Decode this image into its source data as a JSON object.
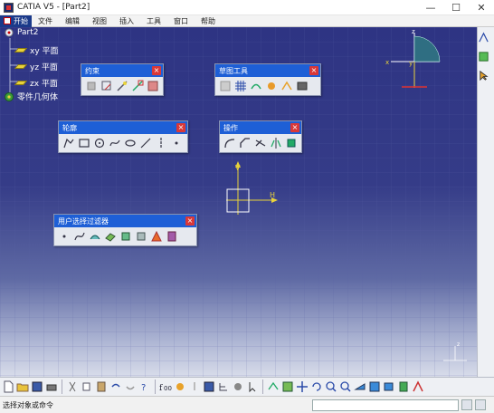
{
  "window": {
    "title": "CATIA V5 - [Part2]",
    "minimize": "—",
    "maximize": "☐",
    "close": "✕"
  },
  "menu": {
    "start": "开始",
    "items": [
      "文件",
      "编辑",
      "视图",
      "插入",
      "工具",
      "窗口",
      "帮助"
    ]
  },
  "tree": {
    "root": "Part2",
    "planes": [
      "xy 平面",
      "yz 平面",
      "zx 平面"
    ],
    "body": "零件几何体"
  },
  "panels": {
    "constraint": "约束",
    "sketch_tools": "草图工具",
    "profile": "轮廓",
    "operation": "操作",
    "user_filter": "用户选择过滤器"
  },
  "compass": {
    "z": "z",
    "x": "x",
    "y": "y"
  },
  "sketch_axes": {
    "h": "H",
    "v": "V"
  },
  "corner_axes": {
    "z": "z"
  },
  "status": {
    "text": "选择对象或命令"
  },
  "colors": {
    "panel_header": "#1e5fd6",
    "viewport_top": "#2e3483",
    "axis": "#e8d23b",
    "close_button": "#d93838"
  }
}
